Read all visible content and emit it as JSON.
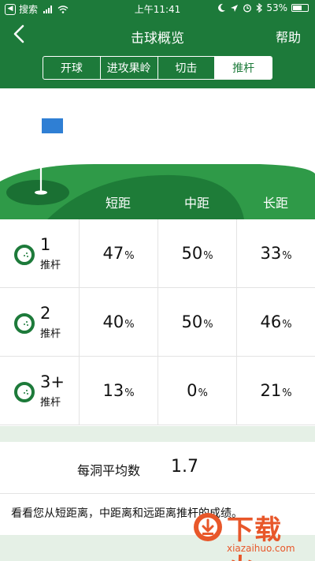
{
  "status_bar": {
    "back_app": "搜索",
    "time": "上午11:41",
    "battery": "53%"
  },
  "nav": {
    "title": "击球概览",
    "help": "帮助"
  },
  "tabs": [
    {
      "label": "开球",
      "active": false
    },
    {
      "label": "进攻果岭",
      "active": false
    },
    {
      "label": "切击",
      "active": false
    },
    {
      "label": "推杆",
      "active": true
    }
  ],
  "columns": [
    "短距",
    "中距",
    "长距"
  ],
  "rows": [
    {
      "putts": "1",
      "label": "推杆",
      "values": [
        "47",
        "50",
        "33"
      ],
      "unit": "%"
    },
    {
      "putts": "2",
      "label": "推杆",
      "values": [
        "40",
        "50",
        "46"
      ],
      "unit": "%"
    },
    {
      "putts": "3+",
      "label": "推杆",
      "values": [
        "13",
        "0",
        "21"
      ],
      "unit": "%"
    }
  ],
  "average": {
    "label": "每洞平均数",
    "value": "1.7"
  },
  "description": "看看您从短距离，中距离和远距离推杆的成绩。",
  "watermark": {
    "text": "下载火",
    "url": "xiazaihuo.com"
  },
  "colors": {
    "brand_green": "#1d7a3a",
    "green_light": "#2f9a48",
    "green_dark": "#166a31",
    "flag_blue": "#2f7fd4",
    "band": "#e5f0e6",
    "watermark_orange": "#e8572a"
  }
}
